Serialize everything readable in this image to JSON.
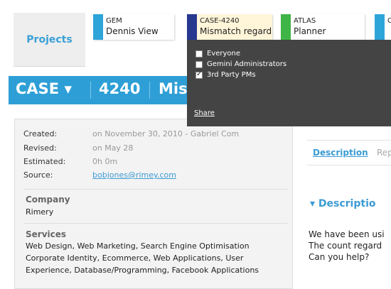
{
  "projects_label": "Projects",
  "project_tabs": [
    {
      "code": "GEM",
      "name": "Dennis View",
      "color": "#2ea5d9",
      "bg": "#ffffff"
    },
    {
      "code": "CASE-4240",
      "name": "Mismatch regard",
      "color": "#27388f",
      "bg": "#fff5d9"
    },
    {
      "code": "ATLAS",
      "name": "Planner",
      "color": "#3fb548",
      "bg": "#ffffff"
    },
    {
      "code": "C",
      "name": "",
      "color": "#2ea5d9",
      "bg": "#ffffff"
    }
  ],
  "case_bar": {
    "project": "CASE ▾",
    "number": "4240",
    "title": "Mis"
  },
  "popup": {
    "options": [
      {
        "label": "Everyone",
        "checked": false
      },
      {
        "label": "Gemini Administrators",
        "checked": false
      },
      {
        "label": "3rd Party PMs",
        "checked": true
      }
    ],
    "share_label": "Share"
  },
  "meta": {
    "created_label": "Created:",
    "created_value": "on November 30, 2010 - Gabriel Com",
    "revised_label": "Revised:",
    "revised_value": "on May 28",
    "estimated_label": "Estimated:",
    "estimated_value": "0h 0m",
    "source_label": "Source:",
    "source_value": "bobjones@rimey.com"
  },
  "company": {
    "title": "Company",
    "value": "Rimery"
  },
  "services": {
    "title": "Services",
    "value": "Web Design, Web Marketing, Search Engine Optimisation Corporate Identity, Ecommerce, Web Applications, User Experience, Database/Programming, Facebook Applications"
  },
  "description_tabs": {
    "active": "Description",
    "inactive": "Rep"
  },
  "description": {
    "header": "▾  Descriptio",
    "line1": "We have been usi",
    "line2": "The count regard",
    "line3": "Can you help?"
  }
}
